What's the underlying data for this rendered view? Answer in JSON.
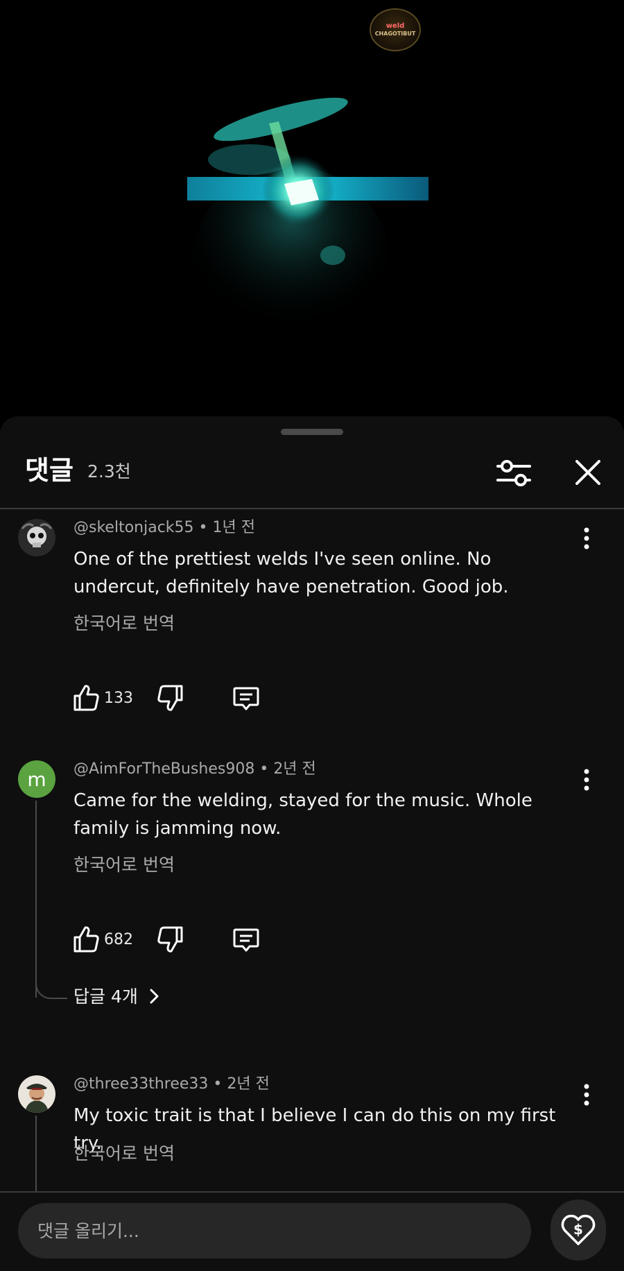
{
  "video": {
    "channel_badge_line1": "weld",
    "channel_badge_line2": "CHAGOTIBUT"
  },
  "comments_panel": {
    "title": "댓글",
    "count": "2.3천",
    "icons": {
      "filter": "sliders-icon",
      "close": "close-icon"
    }
  },
  "comments": [
    {
      "author": "@skeltonjack55",
      "time": "1년 전",
      "text": "One of the prettiest welds I've seen online. No undercut, definitely have penetration. Good job.",
      "translate": "한국어로 번역",
      "likes": "133"
    },
    {
      "author": "@AimForTheBushes908",
      "time": "2년 전",
      "avatar_letter": "m",
      "text": "Came for the welding, stayed for the music. Whole family is jamming now.",
      "translate": "한국어로 번역",
      "likes": "682",
      "replies": "답글 4개"
    },
    {
      "author": "@three33three33",
      "time": "2년 전",
      "text": "My toxic trait is that I believe I can do this on my first try.",
      "translate": "한국어로 번역"
    }
  ],
  "composer": {
    "placeholder": "댓글 올리기...",
    "super_thanks_icon": "heart-dollar-icon"
  },
  "colors": {
    "background": "#0f0f0f",
    "avatar_green": "#5aa340",
    "weld_glow": "#3fe6c8"
  }
}
